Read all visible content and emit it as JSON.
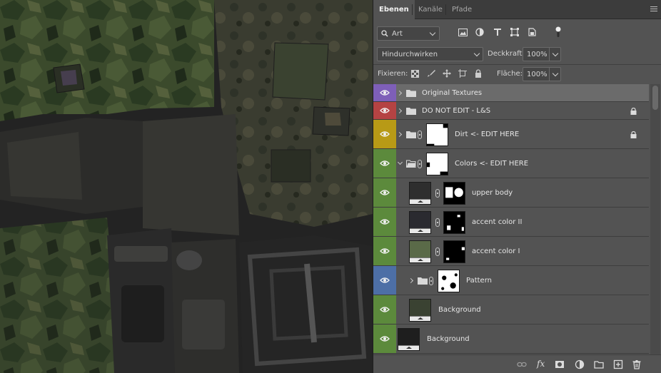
{
  "panel": {
    "tabs": [
      {
        "label": "Ebenen",
        "active": true
      },
      {
        "label": "Kanäle",
        "active": false
      },
      {
        "label": "Pfade",
        "active": false
      }
    ],
    "menu_icon": "panel-menu-icon"
  },
  "filter": {
    "kind_label": "Art",
    "icons": [
      "pixel-filter-icon",
      "adjustment-filter-icon",
      "type-filter-icon",
      "shape-filter-icon",
      "smart-object-filter-icon",
      "filter-toggle-icon"
    ]
  },
  "blend": {
    "mode": "Hindurchwirken",
    "opacity_label": "Deckkraft:",
    "opacity_value": "100%"
  },
  "lock": {
    "label": "Fixieren:",
    "icons": [
      "lock-transparency-icon",
      "lock-pixels-icon",
      "lock-position-icon",
      "lock-artboard-icon",
      "lock-all-icon"
    ],
    "fill_label": "Fläche:",
    "fill_value": "100%"
  },
  "layers": [
    {
      "name": "Original Textures",
      "type": "group",
      "expanded": false,
      "color": "#7e5fb8",
      "locked": false,
      "mask": false,
      "indent": 0,
      "selected": true
    },
    {
      "name": "DO NOT EDIT  - L&S",
      "type": "group",
      "expanded": false,
      "color": "#b54343",
      "locked": true,
      "mask": false,
      "indent": 0,
      "selected": false
    },
    {
      "name": "Dirt <- EDIT HERE",
      "type": "group",
      "expanded": false,
      "color": "#b89a16",
      "locked": true,
      "mask": true,
      "indent": 0,
      "selected": false
    },
    {
      "name": "Colors <- EDIT HERE",
      "type": "group",
      "expanded": true,
      "color": "#5c8a3c",
      "locked": false,
      "mask": true,
      "indent": 0,
      "selected": false
    },
    {
      "name": "upper body",
      "type": "fill",
      "swatch": "#2e2e2e",
      "color": "#5c8a3c",
      "locked": false,
      "mask": true,
      "indent": 1,
      "selected": false
    },
    {
      "name": "accent color II",
      "type": "fill",
      "swatch": "#2a2a30",
      "color": "#5c8a3c",
      "locked": false,
      "mask": true,
      "indent": 1,
      "selected": false
    },
    {
      "name": "accent color I",
      "type": "fill",
      "swatch": "#5a6a48",
      "color": "#5c8a3c",
      "locked": false,
      "mask": true,
      "indent": 1,
      "selected": false
    },
    {
      "name": "Pattern",
      "type": "group",
      "expanded": false,
      "color": "#4d6fa6",
      "locked": false,
      "mask": true,
      "indent": 1,
      "selected": false
    },
    {
      "name": "Background",
      "type": "fill",
      "swatch": "#3a4232",
      "color": "#5c8a3c",
      "locked": false,
      "mask": false,
      "indent": 1,
      "selected": false
    },
    {
      "name": "Background",
      "type": "fill",
      "swatch": "#1e1e1e",
      "color": "#5c8a3c",
      "locked": false,
      "mask": false,
      "indent": 0,
      "selected": false
    }
  ],
  "footer": {
    "icons": [
      "link-layers-icon",
      "fx-icon",
      "add-mask-icon",
      "adjustment-layer-icon",
      "new-group-icon",
      "new-layer-icon",
      "delete-icon"
    ],
    "fx_label": "fx"
  }
}
